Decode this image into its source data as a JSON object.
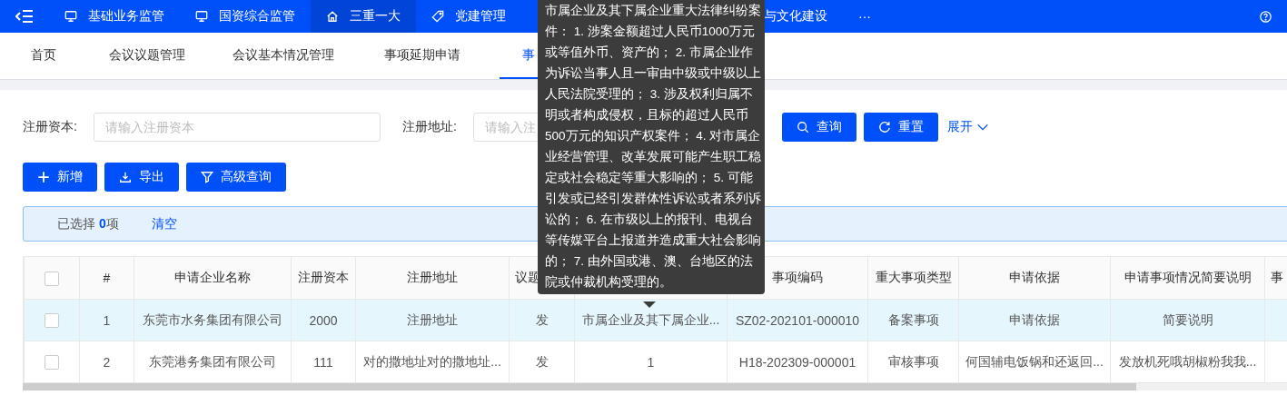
{
  "top_nav": {
    "items": [
      {
        "label": "基础业务监管",
        "selected": false
      },
      {
        "label": "国资综合监管",
        "selected": false
      },
      {
        "label": "三重一大",
        "selected": true
      },
      {
        "label": "党建管理",
        "selected": false
      },
      {
        "label": "与文化建设",
        "selected": false
      }
    ],
    "more": "···"
  },
  "tabs": [
    {
      "label": "首页",
      "selected": false
    },
    {
      "label": "会议议题管理",
      "selected": false
    },
    {
      "label": "会议基本情况管理",
      "selected": false
    },
    {
      "label": "事项延期申请",
      "selected": false
    },
    {
      "label": "事",
      "selected": true
    }
  ],
  "filters": [
    {
      "label": "注册资本:",
      "placeholder": "请输入注册资本"
    },
    {
      "label": "注册地址:",
      "placeholder": "请输入注"
    }
  ],
  "search_buttons": [
    {
      "kind": "primary",
      "label": "查询"
    },
    {
      "kind": "primary",
      "label": "重置"
    },
    {
      "kind": "link",
      "label": "展开"
    }
  ],
  "actions": [
    {
      "label": "新增"
    },
    {
      "label": "导出"
    },
    {
      "label": "高级查询"
    }
  ],
  "selection": {
    "text": "已选择 **0**项",
    "clear": "清空"
  },
  "table": {
    "header_checkbox": {
      "checked": false
    },
    "columns": [
      {
        "label": "#"
      },
      {
        "label": "申请企业名称"
      },
      {
        "label": "注册资本"
      },
      {
        "label": "注册地址"
      },
      {
        "label": "议题"
      },
      {},
      {
        "label": "事项编码"
      },
      {
        "label": "重大事项类型"
      },
      {
        "label": "申请依据"
      },
      {
        "label": "申请事项情况简要说明"
      },
      {
        "label": "事"
      }
    ],
    "rows": [
      {
        "checked": false,
        "hovered": true,
        "cells": [
          "1",
          "东莞市水务集团有限公司",
          "2000",
          "注册地址",
          "发",
          "市属企业及其下属企业...",
          "SZ02-202101-000010",
          "备案事项",
          "申请依据",
          "简要说明"
        ]
      },
      {
        "checked": false,
        "hovered": false,
        "cells": [
          "2",
          "东莞港务集团有限公司",
          "111",
          "对的撒地址对的撒地址...",
          "发",
          "1",
          "H18-202309-000001",
          "审核事项",
          "何国辅电饭锅和还返回...",
          "发放机死哦胡椒粉我我..."
        ]
      }
    ]
  },
  "tooltip": "市属企业及其下属企业重大法律纠纷案件： 1. 涉案金额超过人民币1000万元或等值外币、资产的； 2. 市属企业作为诉讼当事人且一审由中级或中级以上人民法院受理的； 3. 涉及权利归属不明或者构成侵权，且标的超过人民币500万元的知识产权案件； 4. 对市属企业经营管理、改革发展可能产生职工稳定或社会稳定等重大影响的； 5. 可能引发或已经引发群体性诉讼或者系列诉讼的； 6. 在市级以上的报刊、电视台等传媒平台上报道并造成重大社会影响的； 7. 由外国或港、澳、台地区的法院或仲裁机构受理的。"
}
